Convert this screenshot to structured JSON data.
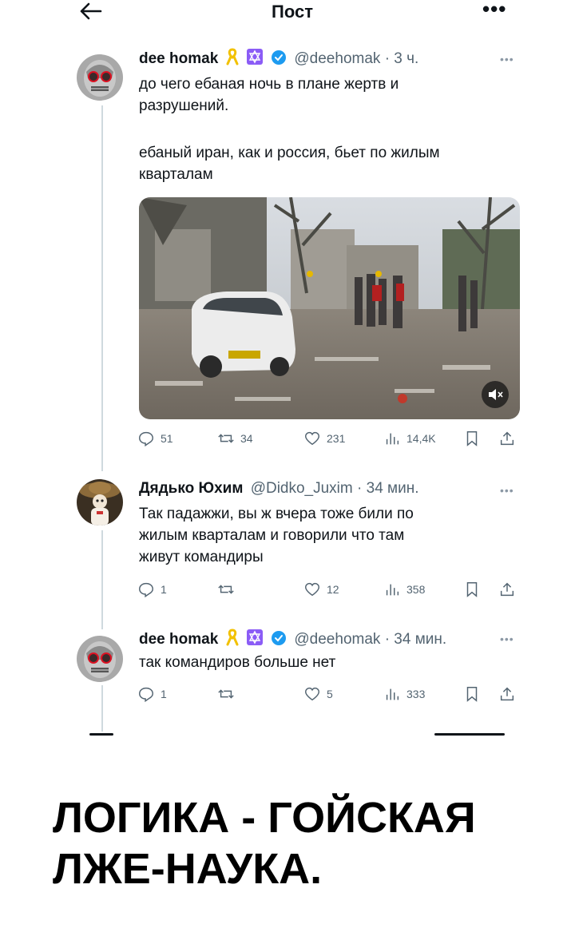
{
  "header": {
    "title": "Пост"
  },
  "tweets": [
    {
      "name": "dee homak",
      "handle": "@deehomak",
      "time": "· 3 ч.",
      "text": [
        "до чего ебаная ночь в плане жертв и",
        "разрушений.",
        "",
        "ебаный иран, как и россия, бьет по жилым",
        "кварталам"
      ],
      "media": true,
      "replies": "51",
      "retweets": "34",
      "likes": "231",
      "views": "14,4K"
    },
    {
      "name": "Дядько Юхим",
      "handle": "@Didko_Juxim",
      "time": "· 34 мин.",
      "text": [
        "Так падажжи, вы ж вчера тоже били по",
        "жилым кварталам и говорили что там",
        "живут командиры"
      ],
      "replies": "1",
      "retweets": "",
      "likes": "12",
      "views": "358"
    },
    {
      "name": "dee homak",
      "handle": "@deehomak",
      "time": "· 34 мин.",
      "text": [
        "так командиров больше нет"
      ],
      "replies": "1",
      "retweets": "",
      "likes": "5",
      "views": "333"
    }
  ],
  "caption": [
    "ЛОГИКА - ГОЙСКАЯ",
    "ЛЖЕ-НАУКА."
  ],
  "colors": {
    "verified": "#1d9bf0",
    "icon": "#536471",
    "text": "#0f1419"
  },
  "icons": [
    "back-arrow-icon",
    "more-icon",
    "ribbon-icon",
    "star-of-david-icon",
    "verified-icon",
    "reply-icon",
    "retweet-icon",
    "like-icon",
    "views-icon",
    "bookmark-icon",
    "share-icon",
    "mute-icon"
  ]
}
